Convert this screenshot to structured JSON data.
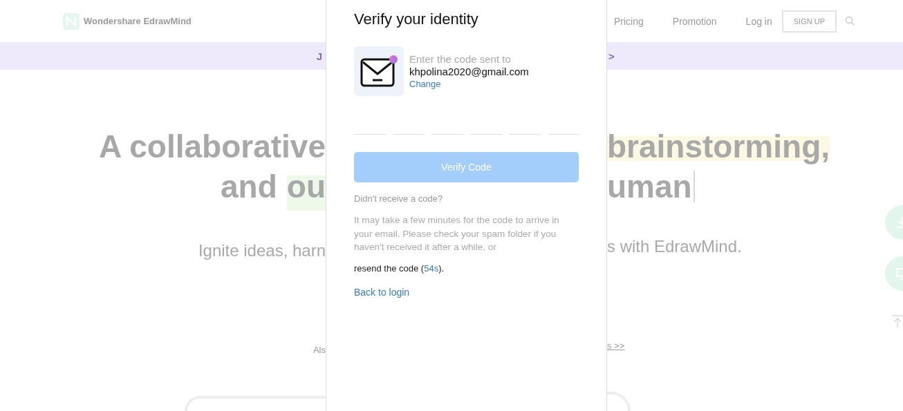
{
  "nav": {
    "logo": "Wondershare EdrawMind",
    "links": [
      "Pricing",
      "Promotion",
      "Log in"
    ],
    "signup": "SIGN UP"
  },
  "banner": {
    "left": "J",
    "right": ">"
  },
  "hero": {
    "line1_left": "A collaborative",
    "line1_right": "brainstorming,",
    "line2_left": "and",
    "line2_left_highlight": "ou",
    "line2_right": "uman",
    "subtitle_left": "Ignite ideas, harn",
    "subtitle_right": "s with EdrawMind.",
    "also_left": "Als",
    "also_right_link": "s >>"
  },
  "modal": {
    "title": "Verify your identity",
    "prompt": "Enter the code sent to",
    "email": "khpolina2020@gmail.com",
    "change_link": "Change",
    "code_inputs": [
      {
        "filled": false
      },
      {
        "filled": false
      },
      {
        "filled": false
      },
      {
        "filled": false
      },
      {
        "filled": false
      },
      {
        "filled": false
      }
    ],
    "verify_button": {
      "label": "Verify Code",
      "disabled": true
    },
    "help_title": "Didn't receive a code?",
    "help_text": "It may take a few minutes for the code to arrive in your email. Please check your spam folder if you haven't received it after a while, or",
    "resend_prefix": "resend the code (",
    "countdown": "54s",
    "resend_suffix": ").",
    "back_link": "Back to login"
  }
}
